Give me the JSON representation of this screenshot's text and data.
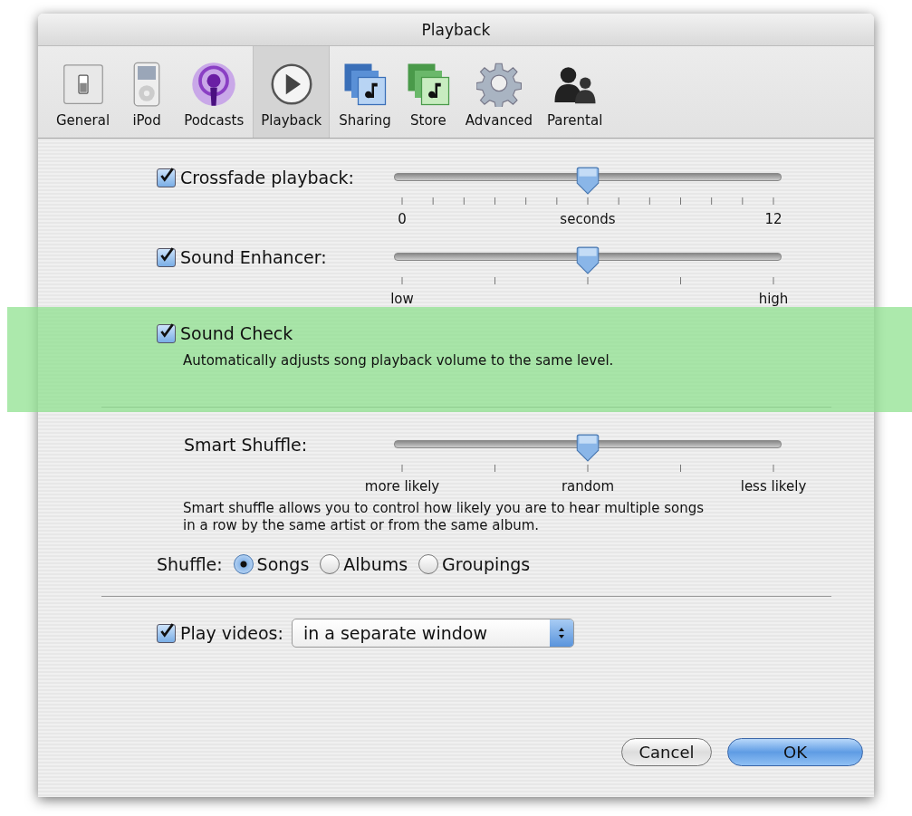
{
  "window": {
    "title": "Playback"
  },
  "toolbar": [
    {
      "label": "General",
      "kind": "switch",
      "selected": false
    },
    {
      "label": "iPod",
      "kind": "player",
      "selected": false
    },
    {
      "label": "Podcasts",
      "kind": "broadcast",
      "selected": false
    },
    {
      "label": "Playback",
      "kind": "play",
      "selected": true
    },
    {
      "label": "Sharing",
      "kind": "note-blue",
      "selected": false
    },
    {
      "label": "Store",
      "kind": "note-green",
      "selected": false
    },
    {
      "label": "Advanced",
      "kind": "gear",
      "selected": false
    },
    {
      "label": "Parental",
      "kind": "people",
      "selected": false
    }
  ],
  "sliders": [
    {
      "kind": "checkbox",
      "label": "Crossfade playback:",
      "checked": true,
      "level": 0.5,
      "scale": {
        "kind": "fine"
      },
      "min_label": "0",
      "mid_label": "seconds",
      "max_label": "12"
    },
    {
      "kind": "checkbox",
      "label": "Sound Enhancer:",
      "checked": true,
      "level": 0.5,
      "scale": {
        "kind": "coarse"
      },
      "min_label": "low",
      "max_label": "high"
    }
  ],
  "sound_check": {
    "label": "Sound Check",
    "checked": true,
    "highlighted": true,
    "description": "Automatically adjusts song playback volume to the same level."
  },
  "smart_shuffle": {
    "kind": "plain",
    "label": "Smart Shuffle:",
    "level": 0.5,
    "scale": {
      "kind": "coarse"
    },
    "min_label": "more likely",
    "mid_label": "random",
    "max_label": "less likely",
    "description": "Smart shuffle allows you to control how likely you are to hear multiple songs in a row by the same artist or from the same album."
  },
  "shuffle": {
    "label": "Shuffle:",
    "options": [
      {
        "label": "Songs",
        "selected": true
      },
      {
        "label": "Albums",
        "selected": false
      },
      {
        "label": "Groupings",
        "selected": false
      }
    ]
  },
  "play_videos": {
    "label": "Play videos:",
    "checked": true,
    "value": "in a separate window"
  },
  "buttons": [
    {
      "label": "Cancel",
      "kind": "secondary"
    },
    {
      "label": "OK",
      "kind": "default"
    }
  ]
}
